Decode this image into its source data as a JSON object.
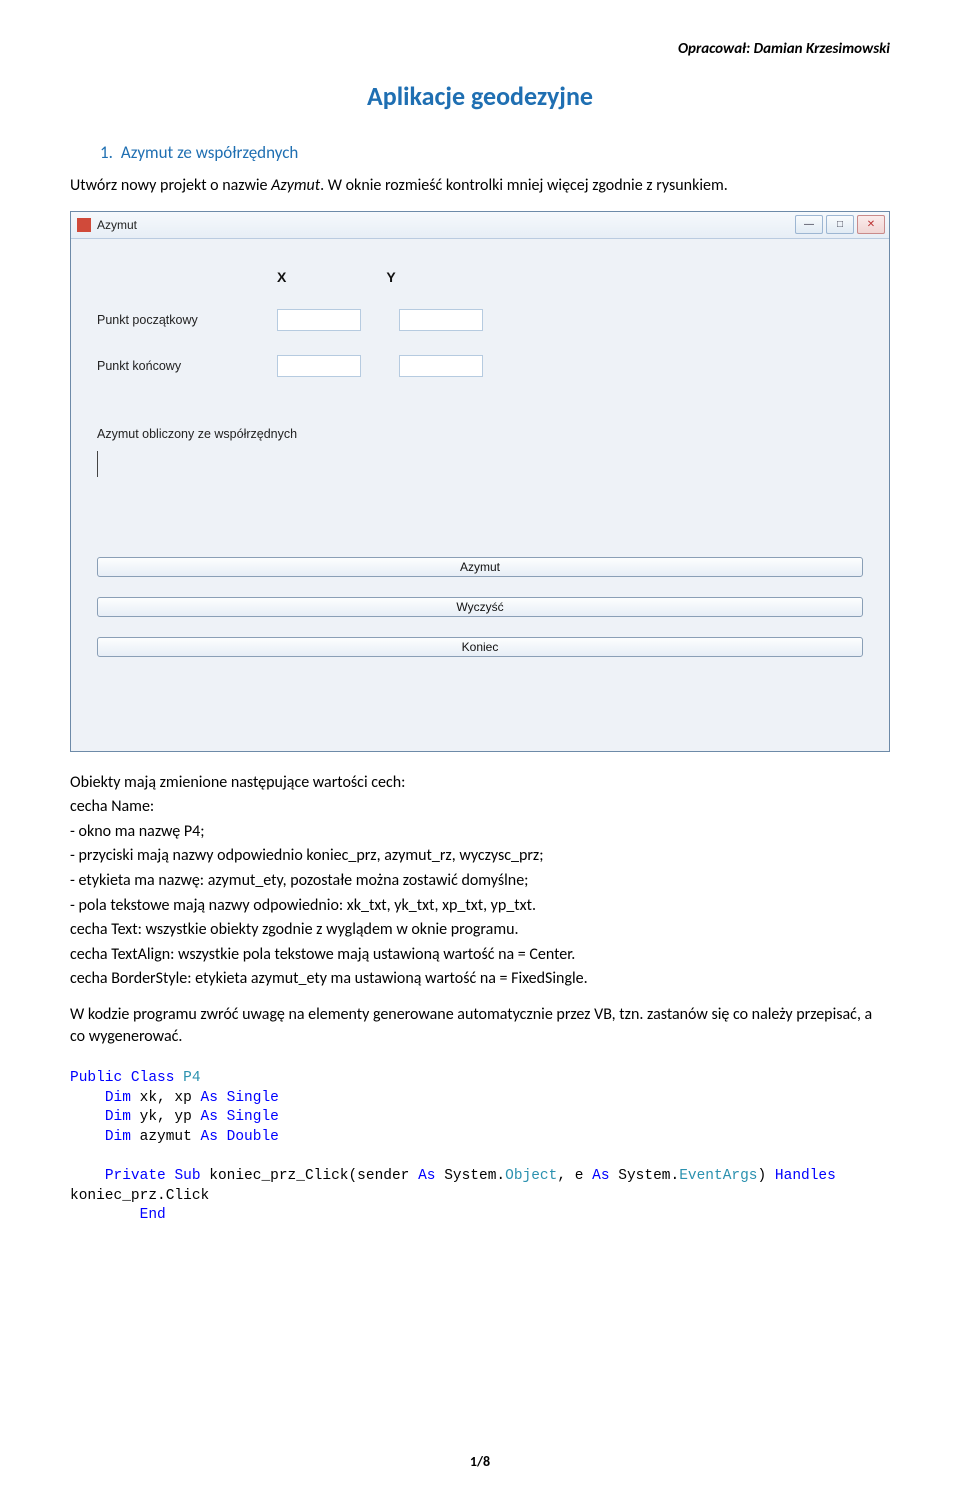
{
  "header": {
    "author": "Opracował: Damian Krzesimowski"
  },
  "doc": {
    "title": "Aplikacje geodezyjne",
    "list1_num": "1.",
    "list1_text": "Azymut ze współrzędnych",
    "intro_a": "Utwórz nowy projekt o nazwie ",
    "intro_a_it": "Azymut",
    "intro_a2": ". W oknie rozmieść kontrolki mniej więcej zgodnie z rysunkiem."
  },
  "azymut": {
    "title": "Azymut",
    "col_x": "X",
    "col_y": "Y",
    "row_start": "Punkt początkowy",
    "row_end": "Punkt końcowy",
    "section": "Azymut obliczony ze współrzędnych",
    "btn_azymut": "Azymut",
    "btn_wyczysc": "Wyczyść",
    "btn_koniec": "Koniec"
  },
  "props": {
    "p0": "Obiekty mają zmienione następujące wartości cech:",
    "p1a": "cecha ",
    "p1b": "Name",
    "p1c": ":",
    "p2a": "- okno ma nazwę ",
    "p2b": "P4",
    "p2c": ";",
    "p3a": "- przyciski mają nazwy odpowiednio ",
    "p3b": "koniec_prz, azymut_rz, wyczysc_prz",
    "p3c": ";",
    "p4a": "- etykieta ma nazwę: ",
    "p4b": "azymut_ety",
    "p4c": ", pozostałe można zostawić domyślne;",
    "p5a": "- pola tekstowe mają nazwy odpowiednio: ",
    "p5b": "xk_txt, yk_txt, xp_txt, yp_txt",
    "p5c": ".",
    "p6a": "cecha ",
    "p6b": "Text",
    "p6c": ": wszystkie obiekty zgodnie z wyglądem w oknie programu.",
    "p7a": "cecha ",
    "p7b": "TextAlign",
    "p7c": ": wszystkie pola tekstowe mają ustawioną wartość na = ",
    "p7d": "Center",
    "p7e": ".",
    "p8a": "cecha ",
    "p8b": "BorderStyle",
    "p8c": ": etykieta ",
    "p8d": "azymut_ety",
    "p8e": " ma ustawioną wartość na = ",
    "p8f": "FixedSingle",
    "p8g": ".",
    "p9": "W kodzie programu zwróć uwagę na elementy generowane automatycznie przez VB, tzn. zastanów się co należy przepisać, a co wygenerować."
  },
  "code": {
    "l1a": "Public",
    "l1b": "Class",
    "l1c": "P4",
    "l2a": "Dim",
    "l2b": " xk, xp ",
    "l2c": "As",
    "l2d": "Single",
    "l3a": "Dim",
    "l3b": " yk, yp ",
    "l3c": "As",
    "l3d": "Single",
    "l4a": "Dim",
    "l4b": " azymut ",
    "l4c": "As",
    "l4d": "Double",
    "l6a": "Private",
    "l6b": "Sub",
    "l6c": " koniec_prz_Click(sender ",
    "l6d": "As",
    "l6e": " System.",
    "l6f": "Object",
    "l6g": ", e ",
    "l6h": "As",
    "l6i": " System.",
    "l6j": "EventArgs",
    "l6k": ") ",
    "l6l": "Handles",
    "l7": "koniec_prz.Click",
    "l8": "End"
  },
  "footer": {
    "page": "1/8"
  }
}
